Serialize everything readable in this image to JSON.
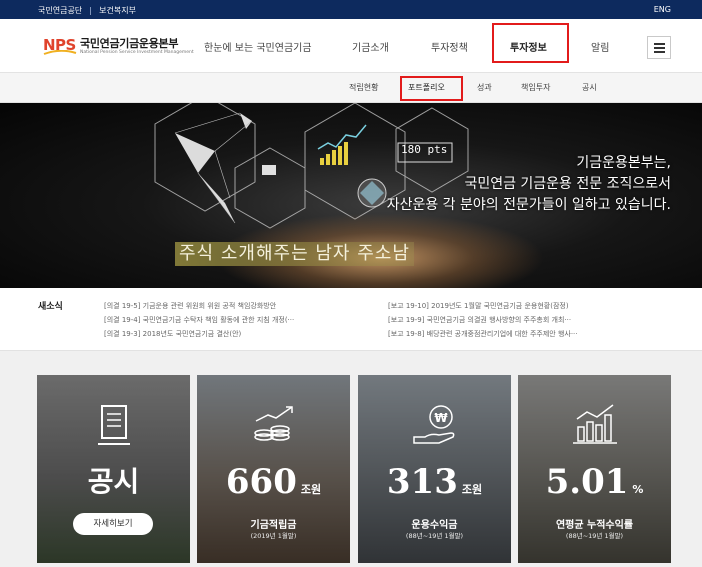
{
  "util": {
    "links": [
      "국민연금공단",
      "보건복지부"
    ],
    "lang": "ENG"
  },
  "logo": {
    "mark": "NPS",
    "name_kr": "국민연금기금운용본부",
    "name_en": "National Pension Service Investment Management"
  },
  "gnb": [
    {
      "label": "한눈에 보는 국민연금기금",
      "active": false
    },
    {
      "label": "기금소개",
      "active": false
    },
    {
      "label": "투자정책",
      "active": false
    },
    {
      "label": "투자정보",
      "active": true
    },
    {
      "label": "알림",
      "active": false
    }
  ],
  "snb": [
    {
      "label": "적립현황",
      "active": false
    },
    {
      "label": "포트폴리오",
      "active": true
    },
    {
      "label": "성과",
      "active": false
    },
    {
      "label": "책임투자",
      "active": false
    },
    {
      "label": "공시",
      "active": false
    }
  ],
  "hero": {
    "line1": "기금운용본부는,",
    "line2": "국민연금 기금운용 전문 조직으로서",
    "line3": "자산운용 각 분야의 전문가들이 일하고 있습니다.",
    "overlay_caption": "주식 소개해주는 남자 주소남",
    "graphic_label": "180 pts"
  },
  "news": {
    "title": "새소식",
    "left": [
      "[의결 19-5] 기금운용 관련 위원회 위원 공적 책임강화방안",
      "[의결 19-4] 국민연금기금 수탁자 책임 활동에 관한 지침 개정(···",
      "[의결 19-3] 2018년도 국민연금기금 결산(안)"
    ],
    "right": [
      "[보고 19-10] 2019년도 1월말 국민연금기금 운용현황(잠정)",
      "[보고 19-9] 국민연금기금 의결권 행사방향의 주주총회 개최···",
      "[보고 19-8] 배당관련 공개중점관리기업에 대한 주주제안 행사···"
    ]
  },
  "cards": [
    {
      "icon": "document-icon",
      "big": "공시",
      "button": "자세히보기"
    },
    {
      "icon": "coins-growth-icon",
      "big": "660",
      "unit": "조원",
      "label": "기금적립금",
      "sub": "(2019년 1월말)"
    },
    {
      "icon": "won-hand-icon",
      "big": "313",
      "unit": "조원",
      "label": "운용수익금",
      "sub": "(88년~19년 1월말)"
    },
    {
      "icon": "bar-chart-icon",
      "big": "5.01",
      "unit": "%",
      "label": "연평균 누적수익률",
      "sub": "(88년~19년 1월말)"
    }
  ]
}
